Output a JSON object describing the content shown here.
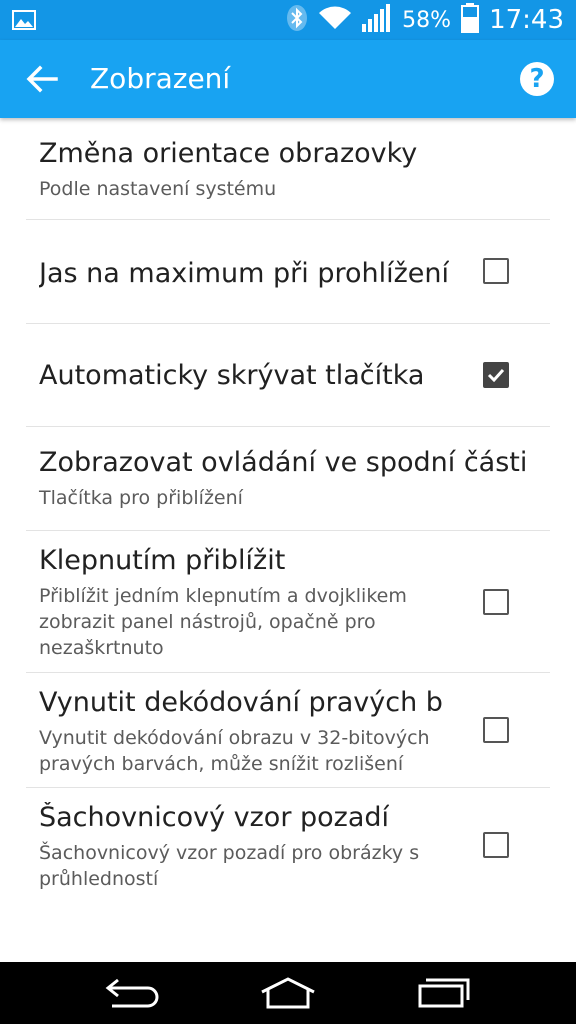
{
  "status": {
    "battery": "58%",
    "time": "17:43",
    "icons": [
      "image-notification-icon",
      "bluetooth-icon",
      "wifi-icon",
      "signal-icon",
      "battery-icon"
    ]
  },
  "appbar": {
    "title": "Zobrazení",
    "back_icon": "arrow-left-icon",
    "help_icon": "help-icon",
    "help_glyph": "?",
    "color": "#18a3f2"
  },
  "settings": [
    {
      "title": "Změna orientace obrazovky",
      "subtitle": "Podle nastavení systému"
    },
    {
      "title": "Jas na maximum při prohlížení",
      "checked": false
    },
    {
      "title": "Automaticky skrývat tlačítka",
      "checked": true
    },
    {
      "title": "Zobrazovat ovládání ve spodní části",
      "subtitle": "Tlačítka pro přiblížení"
    },
    {
      "title": "Klepnutím přiblížit",
      "subtitle_lines": [
        "Přiblížit jedním klepnutím a dvojklikem",
        "zobrazit panel nástrojů, opačně pro",
        "nezaškrtnuto"
      ],
      "checked": false
    },
    {
      "title": "Vynutit dekódování pravých bar",
      "subtitle_lines": [
        "Vynutit dekódování obrazu v 32-bitových",
        "pravých barvách, může snížit rozlišení"
      ],
      "checked": false
    },
    {
      "title": "Šachovnicový vzor pozadí",
      "subtitle_lines": [
        "Šachovnicový vzor pozadí pro obrázky s",
        "průhledností"
      ],
      "checked": false
    }
  ],
  "navbar": [
    "back-nav-icon",
    "home-nav-icon",
    "recents-nav-icon"
  ]
}
